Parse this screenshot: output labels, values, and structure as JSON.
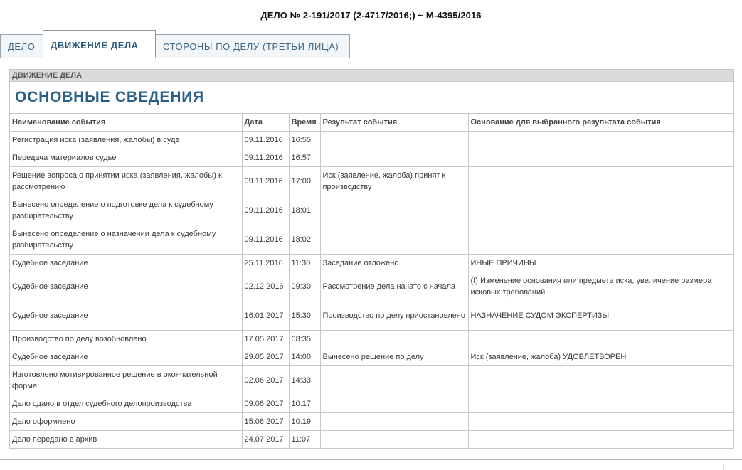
{
  "case": {
    "title": "ДЕЛО № 2-191/2017 (2-4717/2016;) ~ М-4395/2016"
  },
  "tabs": [
    {
      "label": "ДЕЛО",
      "active": false
    },
    {
      "label": "ДВИЖЕНИЕ ДЕЛА",
      "active": true
    },
    {
      "label": "СТОРОНЫ ПО ДЕЛУ (ТРЕТЬИ ЛИЦА)",
      "active": false
    }
  ],
  "panel": {
    "header": "ДВИЖЕНИЕ ДЕЛА",
    "section_title": "ОСНОВНЫЕ СВЕДЕНИЯ"
  },
  "table": {
    "headers": [
      "Наименование события",
      "Дата",
      "Время",
      "Результат события",
      "Основание для выбранного результата события"
    ],
    "rows": [
      [
        "Регистрация иска (заявления, жалобы) в суде",
        "09.11.2016",
        "16:55",
        "",
        ""
      ],
      [
        "Передача материалов судье",
        "09.11.2016",
        "16:57",
        "",
        ""
      ],
      [
        "Решение вопроса о принятии иска (заявления, жалобы) к рассмотрению",
        "09.11.2016",
        "17:00",
        "Иск (заявление, жалоба) принят к производству",
        ""
      ],
      [
        "Вынесено определение о подготовке дела к судебному разбирательству",
        "09.11.2016",
        "18:01",
        "",
        ""
      ],
      [
        "Вынесено определение о назначении дела к судебному разбирательству",
        "09.11.2016",
        "18:02",
        "",
        ""
      ],
      [
        "Судебное заседание",
        "25.11.2016",
        "11:30",
        "Заседание отложено",
        "ИНЫЕ ПРИЧИНЫ"
      ],
      [
        "Судебное заседание",
        "02.12.2016",
        "09:30",
        "Рассмотрение дела начато с начала",
        "(!) Изменение основания или предмета иска, увеличение размера исковых требований"
      ],
      [
        "Судебное заседание",
        "16.01.2017",
        "15:30",
        "Производство по делу приостановлено",
        "НАЗНАЧЕНИЕ СУДОМ ЭКСПЕРТИЗЫ"
      ],
      [
        "Производство по делу возобновлено",
        "17.05.2017",
        "08:35",
        "",
        ""
      ],
      [
        "Судебное заседание",
        "29.05.2017",
        "14:00",
        "Вынесено решение по делу",
        "Иск (заявление, жалоба) УДОВЛЕТВОРЕН"
      ],
      [
        "Изготовлено мотивированное решение в окончательной форме",
        "02.06.2017",
        "14:33",
        "",
        ""
      ],
      [
        "Дело сдано в отдел судебного делопроизводства",
        "09.06.2017",
        "10:17",
        "",
        ""
      ],
      [
        "Дело оформлено",
        "15.06.2017",
        "10:19",
        "",
        ""
      ],
      [
        "Дело передано в архив",
        "24.07.2017",
        "11:07",
        "",
        ""
      ]
    ]
  }
}
